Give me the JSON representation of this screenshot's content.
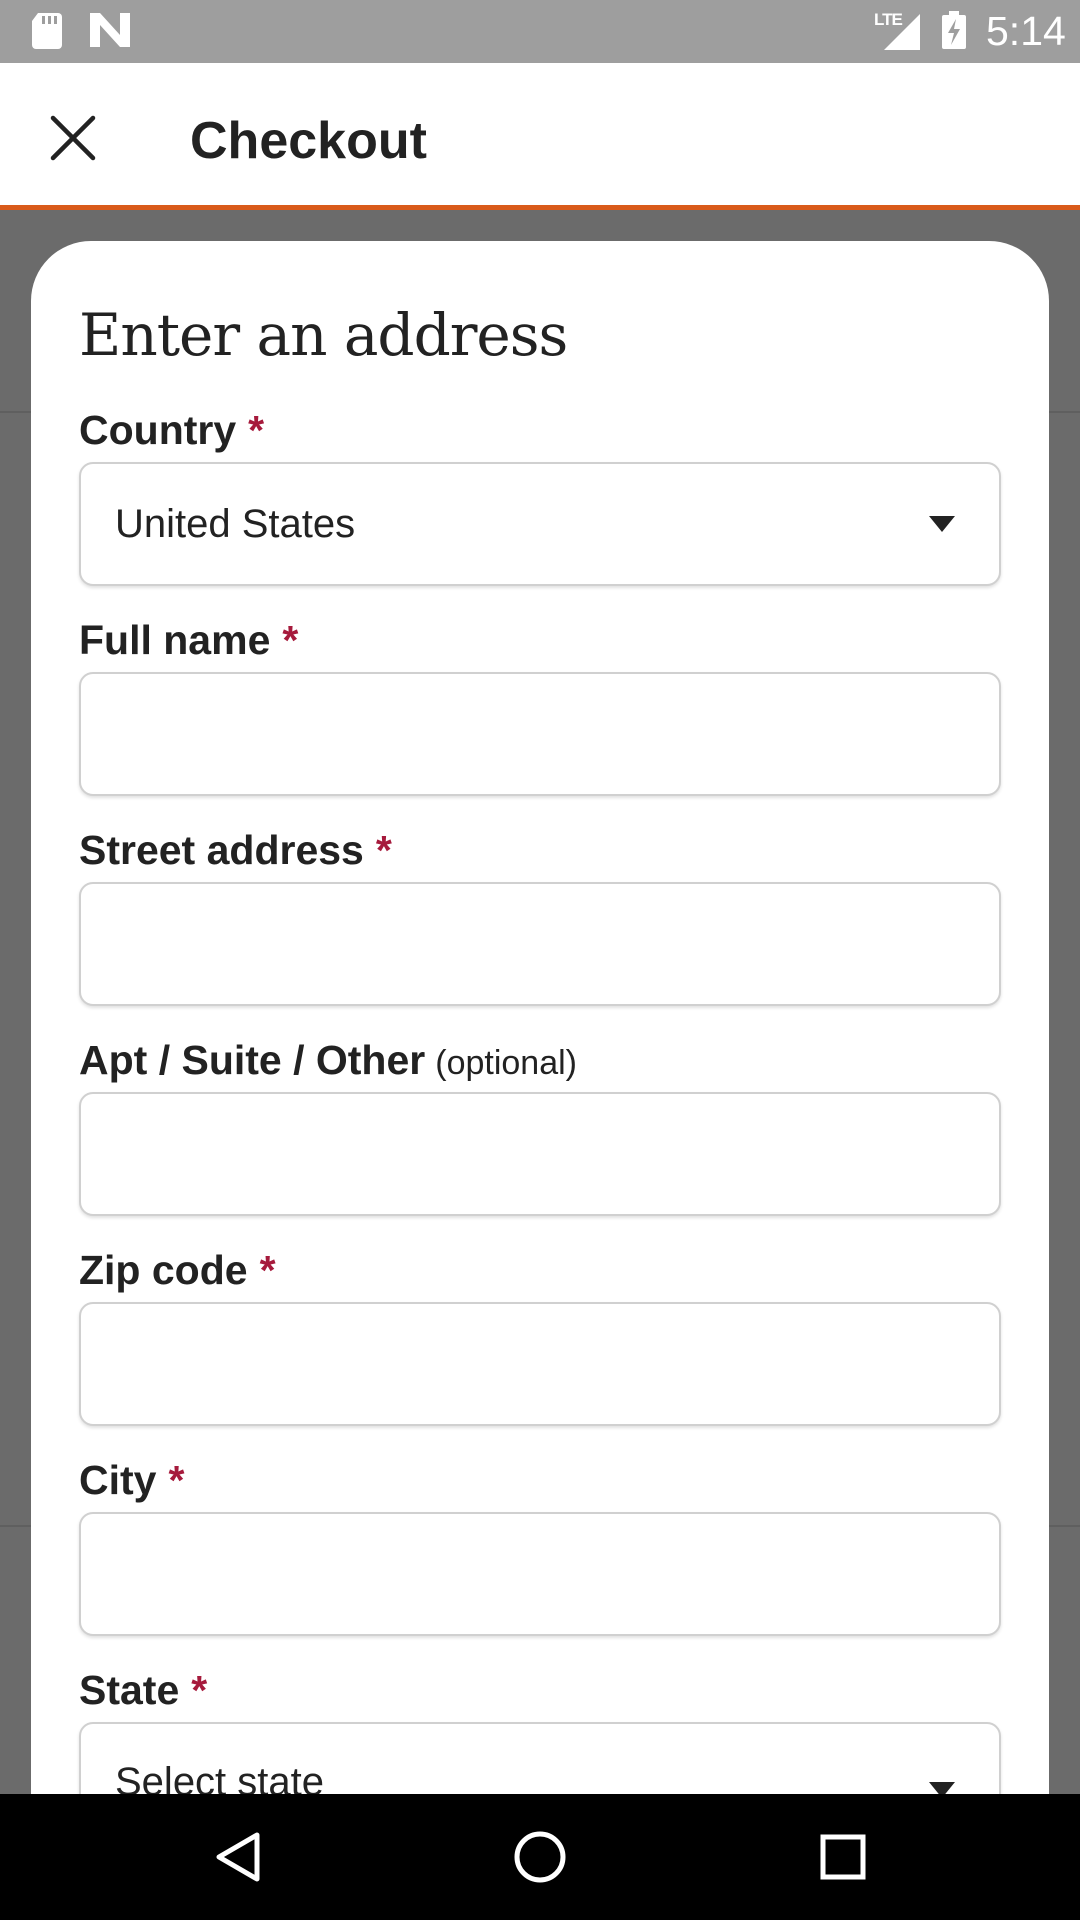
{
  "status_bar": {
    "network": "LTE",
    "time": "5:14",
    "icons": [
      "sd-card-icon",
      "n-icon",
      "signal-icon",
      "battery-charging-icon"
    ]
  },
  "app_bar": {
    "title": "Checkout",
    "close_icon": "close-icon"
  },
  "form": {
    "title": "Enter an address",
    "required_marker": "*",
    "fields": {
      "country": {
        "label": "Country",
        "value": "United States"
      },
      "full_name": {
        "label": "Full name",
        "value": ""
      },
      "street": {
        "label": "Street address",
        "value": ""
      },
      "apt": {
        "label": "Apt / Suite / Other",
        "optional": "(optional)",
        "value": ""
      },
      "zip": {
        "label": "Zip code",
        "value": ""
      },
      "city": {
        "label": "City",
        "value": ""
      },
      "state": {
        "label": "State",
        "value": "Select state"
      }
    }
  },
  "nav_bar": {
    "icons": [
      "back-icon",
      "home-icon",
      "recents-icon"
    ]
  },
  "colors": {
    "accent": "#d95a1a",
    "required": "#a61a3c",
    "scrim": "#6b6b6b"
  }
}
